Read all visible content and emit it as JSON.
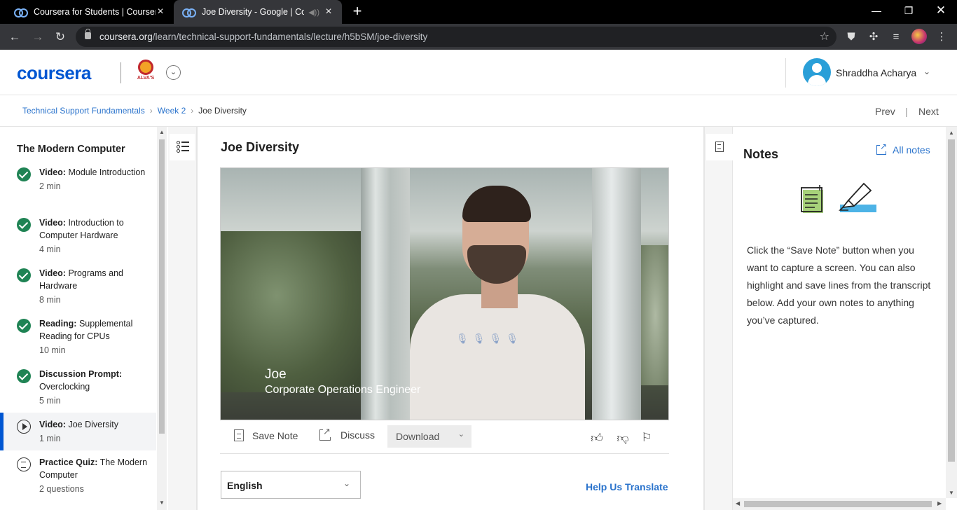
{
  "browser": {
    "tabs": [
      {
        "title": "Coursera for Students | Coursera",
        "active": false
      },
      {
        "title": "Joe Diversity - Google | Coursera",
        "active": true
      }
    ],
    "url_host": "coursera.org",
    "url_path": "/learn/technical-support-fundamentals/lecture/h5bSM/joe-diversity"
  },
  "header": {
    "logo": "coursera",
    "partner_text": "ALVA'S",
    "user_name": "Shraddha Acharya"
  },
  "breadcrumb": {
    "course": "Technical Support Fundamentals",
    "week": "Week 2",
    "current": "Joe Diversity",
    "sep": "›"
  },
  "pager": {
    "prev": "Prev",
    "divider": "|",
    "next": "Next"
  },
  "sidebar": {
    "title": "The Modern Computer",
    "items": [
      {
        "type": "Video:",
        "title": " Module Introduction",
        "meta": "2 min",
        "status": "done"
      },
      {
        "type": "Video:",
        "title": " Introduction to Computer Hardware",
        "meta": "4 min",
        "status": "done"
      },
      {
        "type": "Video:",
        "title": " Programs and Hardware",
        "meta": "8 min",
        "status": "done"
      },
      {
        "type": "Reading:",
        "title": " Supplemental Reading for CPUs",
        "meta": "10 min",
        "status": "done"
      },
      {
        "type": "Discussion Prompt:",
        "title": " Overclocking",
        "meta": "5 min",
        "status": "done"
      },
      {
        "type": "Video:",
        "title": " Joe Diversity",
        "meta": "1 min",
        "status": "current"
      },
      {
        "type": "Practice Quiz:",
        "title": " The Modern Computer",
        "meta": "2 questions",
        "status": "quiz"
      }
    ]
  },
  "main": {
    "title": "Joe Diversity",
    "video": {
      "caption_name": "Joe",
      "caption_role": "Corporate Operations Engineer"
    },
    "actions": {
      "save_note": "Save Note",
      "discuss": "Discuss",
      "download": "Download"
    },
    "language": "English",
    "help_translate": "Help Us Translate"
  },
  "notes": {
    "title": "Notes",
    "all_notes": "All notes",
    "description": "Click the “Save Note” button when you want to capture a screen. You can also highlight and save lines from the transcript below. Add your own notes to anything you’ve captured."
  },
  "colors": {
    "brand": "#0056d2",
    "link": "#2a73cc",
    "complete": "#1f8354",
    "highlight": "#4db3e6"
  }
}
